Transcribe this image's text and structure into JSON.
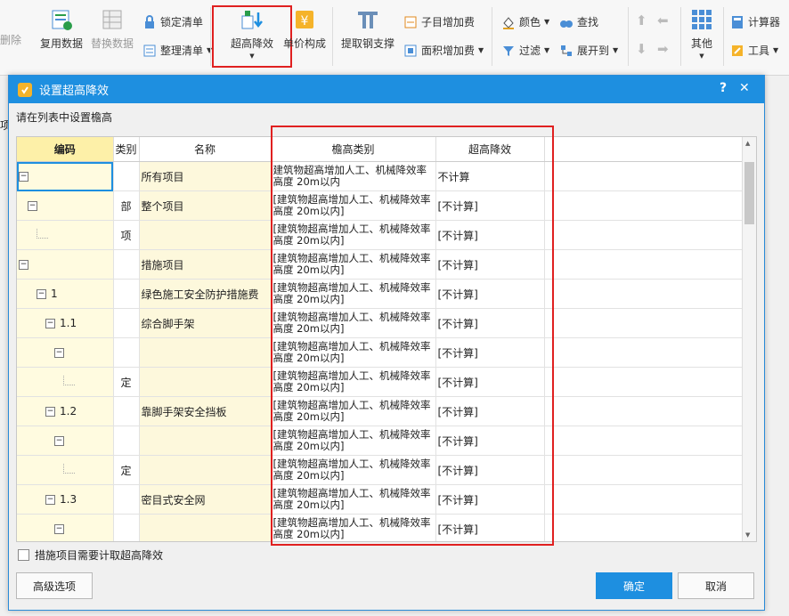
{
  "ribbon": {
    "delete": "删除",
    "reuse": "复用数据",
    "replace": "替换数据",
    "lock_list": "锁定清单",
    "organize_list": "整理清单",
    "super_high": "超高降效",
    "unit_price": "单价构成",
    "extract_steel": "提取钢支撑",
    "sub_item_fee": "子目增加费",
    "area_fee": "面积增加费",
    "color": "颜色",
    "find": "查找",
    "filter": "过滤",
    "expand_to": "展开到",
    "other": "其他",
    "calculator": "计算器",
    "tools": "工具",
    "side_label": "项"
  },
  "dialog": {
    "title": "设置超高降效",
    "help": "?",
    "close": "✕",
    "hint": "请在列表中设置檐高",
    "columns": [
      "编码",
      "类别",
      "名称",
      "檐高类别",
      "超高降效"
    ],
    "rows": [
      {
        "code": "",
        "type": "",
        "name": "所有项目",
        "height": "建筑物超高增加人工、机械降效率 高度 20m以内",
        "reduce": "不计算"
      },
      {
        "code": "",
        "type": "部",
        "name": "整个项目",
        "height": "[建筑物超高增加人工、机械降效率 高度 20m以内]",
        "reduce": "[不计算]"
      },
      {
        "code": "",
        "type": "项",
        "name": "",
        "height": "[建筑物超高增加人工、机械降效率 高度 20m以内]",
        "reduce": "[不计算]"
      },
      {
        "code": "",
        "type": "",
        "name": "措施项目",
        "height": "[建筑物超高增加人工、机械降效率 高度 20m以内]",
        "reduce": "[不计算]"
      },
      {
        "code": "1",
        "type": "",
        "name": "绿色施工安全防护措施费",
        "height": "[建筑物超高增加人工、机械降效率 高度 20m以内]",
        "reduce": "[不计算]"
      },
      {
        "code": "1.1",
        "type": "",
        "name": "综合脚手架",
        "height": "[建筑物超高增加人工、机械降效率 高度 20m以内]",
        "reduce": "[不计算]"
      },
      {
        "code": "",
        "type": "",
        "name": "",
        "height": "[建筑物超高增加人工、机械降效率 高度 20m以内]",
        "reduce": "[不计算]"
      },
      {
        "code": "",
        "type": "定",
        "name": "",
        "height": "[建筑物超高增加人工、机械降效率 高度 20m以内]",
        "reduce": "[不计算]"
      },
      {
        "code": "1.2",
        "type": "",
        "name": "靠脚手架安全挡板",
        "height": "[建筑物超高增加人工、机械降效率 高度 20m以内]",
        "reduce": "[不计算]"
      },
      {
        "code": "",
        "type": "",
        "name": "",
        "height": "[建筑物超高增加人工、机械降效率 高度 20m以内]",
        "reduce": "[不计算]"
      },
      {
        "code": "",
        "type": "定",
        "name": "",
        "height": "[建筑物超高增加人工、机械降效率 高度 20m以内]",
        "reduce": "[不计算]"
      },
      {
        "code": "1.3",
        "type": "",
        "name": "密目式安全网",
        "height": "[建筑物超高增加人工、机械降效率 高度 20m以内]",
        "reduce": "[不计算]"
      },
      {
        "code": "",
        "type": "",
        "name": "",
        "height": "[建筑物超高增加人工、机械降效率 高度 20m以内]",
        "reduce": "[不计算]"
      }
    ],
    "checkbox_label": "措施项目需要计取超高降效",
    "advanced": "高级选项",
    "ok": "确定",
    "cancel": "取消"
  },
  "colors": {
    "accent": "#1e8fe0",
    "highlight": "#e02020",
    "code_header": "#fdf0a8"
  }
}
